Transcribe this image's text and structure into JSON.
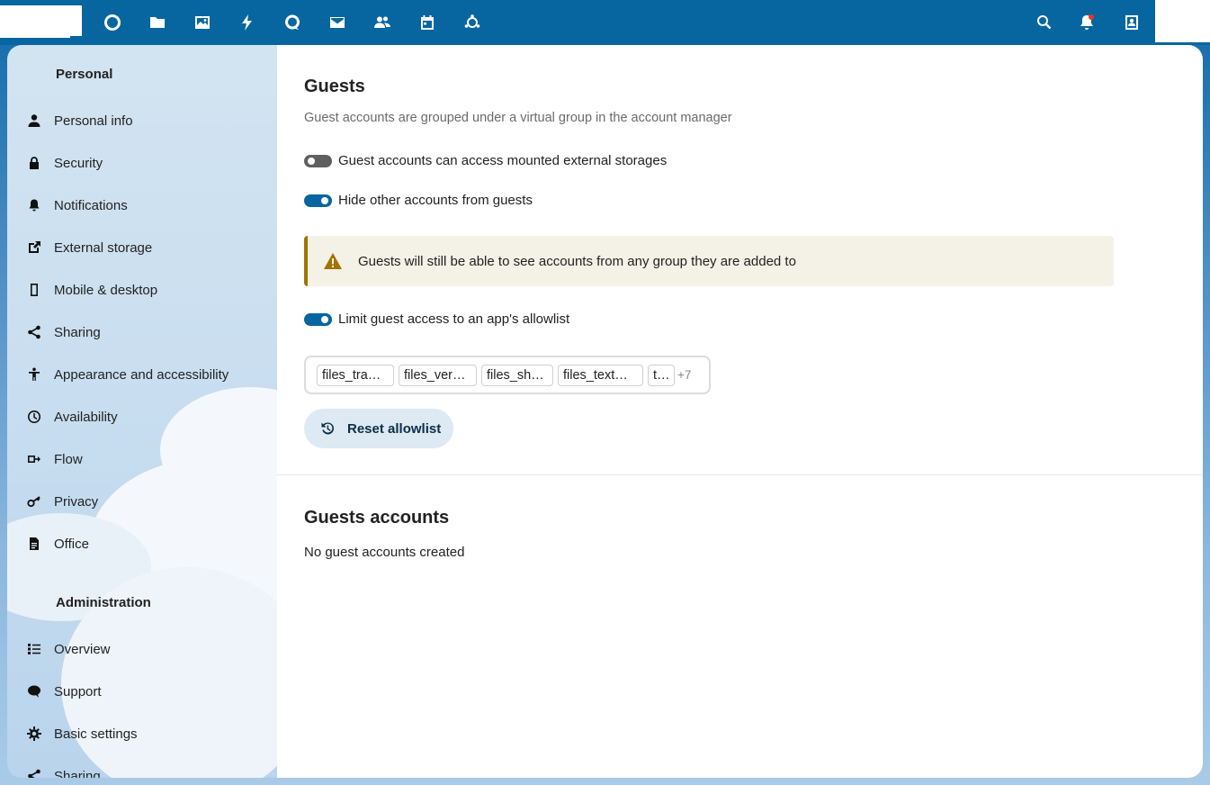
{
  "sidebar": {
    "personal_heading": "Personal",
    "personal_items": [
      {
        "label": "Personal info",
        "icon": "person-icon"
      },
      {
        "label": "Security",
        "icon": "lock-icon"
      },
      {
        "label": "Notifications",
        "icon": "bell-icon"
      },
      {
        "label": "External storage",
        "icon": "external-link-icon"
      },
      {
        "label": "Mobile & desktop",
        "icon": "phone-icon"
      },
      {
        "label": "Sharing",
        "icon": "share-icon"
      },
      {
        "label": "Appearance and accessibility",
        "icon": "accessibility-icon"
      },
      {
        "label": "Availability",
        "icon": "clock-icon"
      },
      {
        "label": "Flow",
        "icon": "flow-icon"
      },
      {
        "label": "Privacy",
        "icon": "key-icon"
      },
      {
        "label": "Office",
        "icon": "document-icon"
      }
    ],
    "admin_heading": "Administration",
    "admin_items": [
      {
        "label": "Overview",
        "icon": "list-icon"
      },
      {
        "label": "Support",
        "icon": "chat-icon"
      },
      {
        "label": "Basic settings",
        "icon": "gear-icon"
      },
      {
        "label": "Sharing",
        "icon": "share-icon"
      }
    ]
  },
  "guests": {
    "title": "Guests",
    "description": "Guest accounts are grouped under a virtual group in the account manager",
    "toggle_external": {
      "label": "Guest accounts can access mounted external storages",
      "on": false
    },
    "toggle_hide": {
      "label": "Hide other accounts from guests",
      "on": true
    },
    "warning": "Guests will still be able to see accounts from any group they are added to",
    "toggle_allowlist": {
      "label": "Limit guest access to an app's allowlist",
      "on": true
    },
    "allowlist_chips": [
      "files_tra…",
      "files_ver…",
      "files_sh…",
      "files_text…",
      "t…"
    ],
    "allowlist_more": "+7",
    "reset_label": "Reset allowlist"
  },
  "accounts": {
    "title": "Guests accounts",
    "empty": "No guest accounts created"
  },
  "colors": {
    "header": "#07669f",
    "accent": "#07669f",
    "warning_border": "#a37200",
    "warning_bg": "#f4f1e6"
  }
}
